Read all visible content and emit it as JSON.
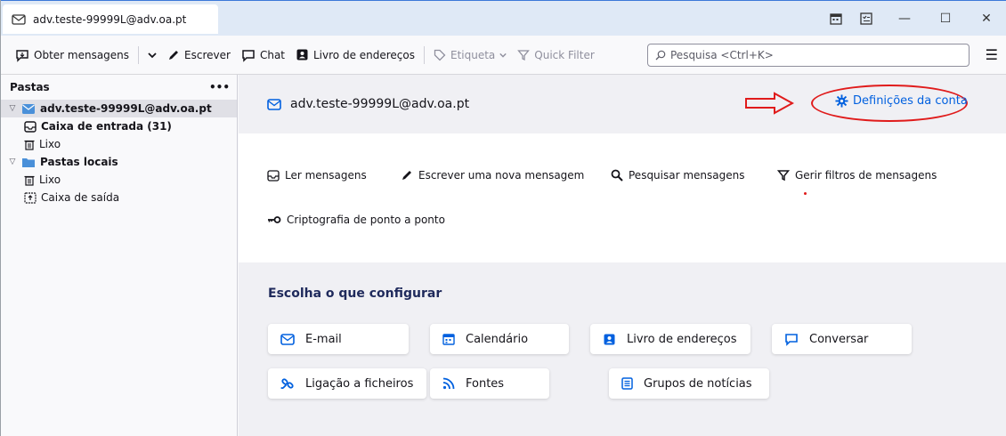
{
  "window": {
    "tab_title": "adv.teste-99999L@adv.oa.pt",
    "minimize": "—",
    "maximize": "☐",
    "close": "✕"
  },
  "toolbar": {
    "get_messages": "Obter mensagens",
    "write": "Escrever",
    "chat": "Chat",
    "address_book": "Livro de endereços",
    "tag": "Etiqueta",
    "quick_filter": "Quick Filter",
    "search_placeholder": "Pesquisa <Ctrl+K>",
    "menu": "☰"
  },
  "folders": {
    "header": "Pastas",
    "more": "•••",
    "account": "adv.teste-99999L@adv.oa.pt",
    "inbox": "Caixa de entrada (31)",
    "trash1": "Lixo",
    "local": "Pastas locais",
    "trash2": "Lixo",
    "outbox": "Caixa de saída"
  },
  "main": {
    "account_email": "adv.teste-99999L@adv.oa.pt",
    "settings_link": "Definições da conta",
    "actions": {
      "read": "Ler mensagens",
      "compose": "Escrever uma nova mensagem",
      "search": "Pesquisar mensagens",
      "filters": "Gerir filtros de mensagens",
      "e2e": "Criptografia de ponto a ponto"
    },
    "choose_title": "Escolha o que configurar",
    "setup": {
      "email": "E-mail",
      "calendar": "Calendário",
      "address_book": "Livro de endereços",
      "chat": "Conversar",
      "filelink": "Ligação a ficheiros",
      "feeds": "Fontes",
      "newsgroups": "Grupos de notícias"
    }
  },
  "colors": {
    "accent": "#0060df",
    "annotation_red": "#e01b1b"
  }
}
